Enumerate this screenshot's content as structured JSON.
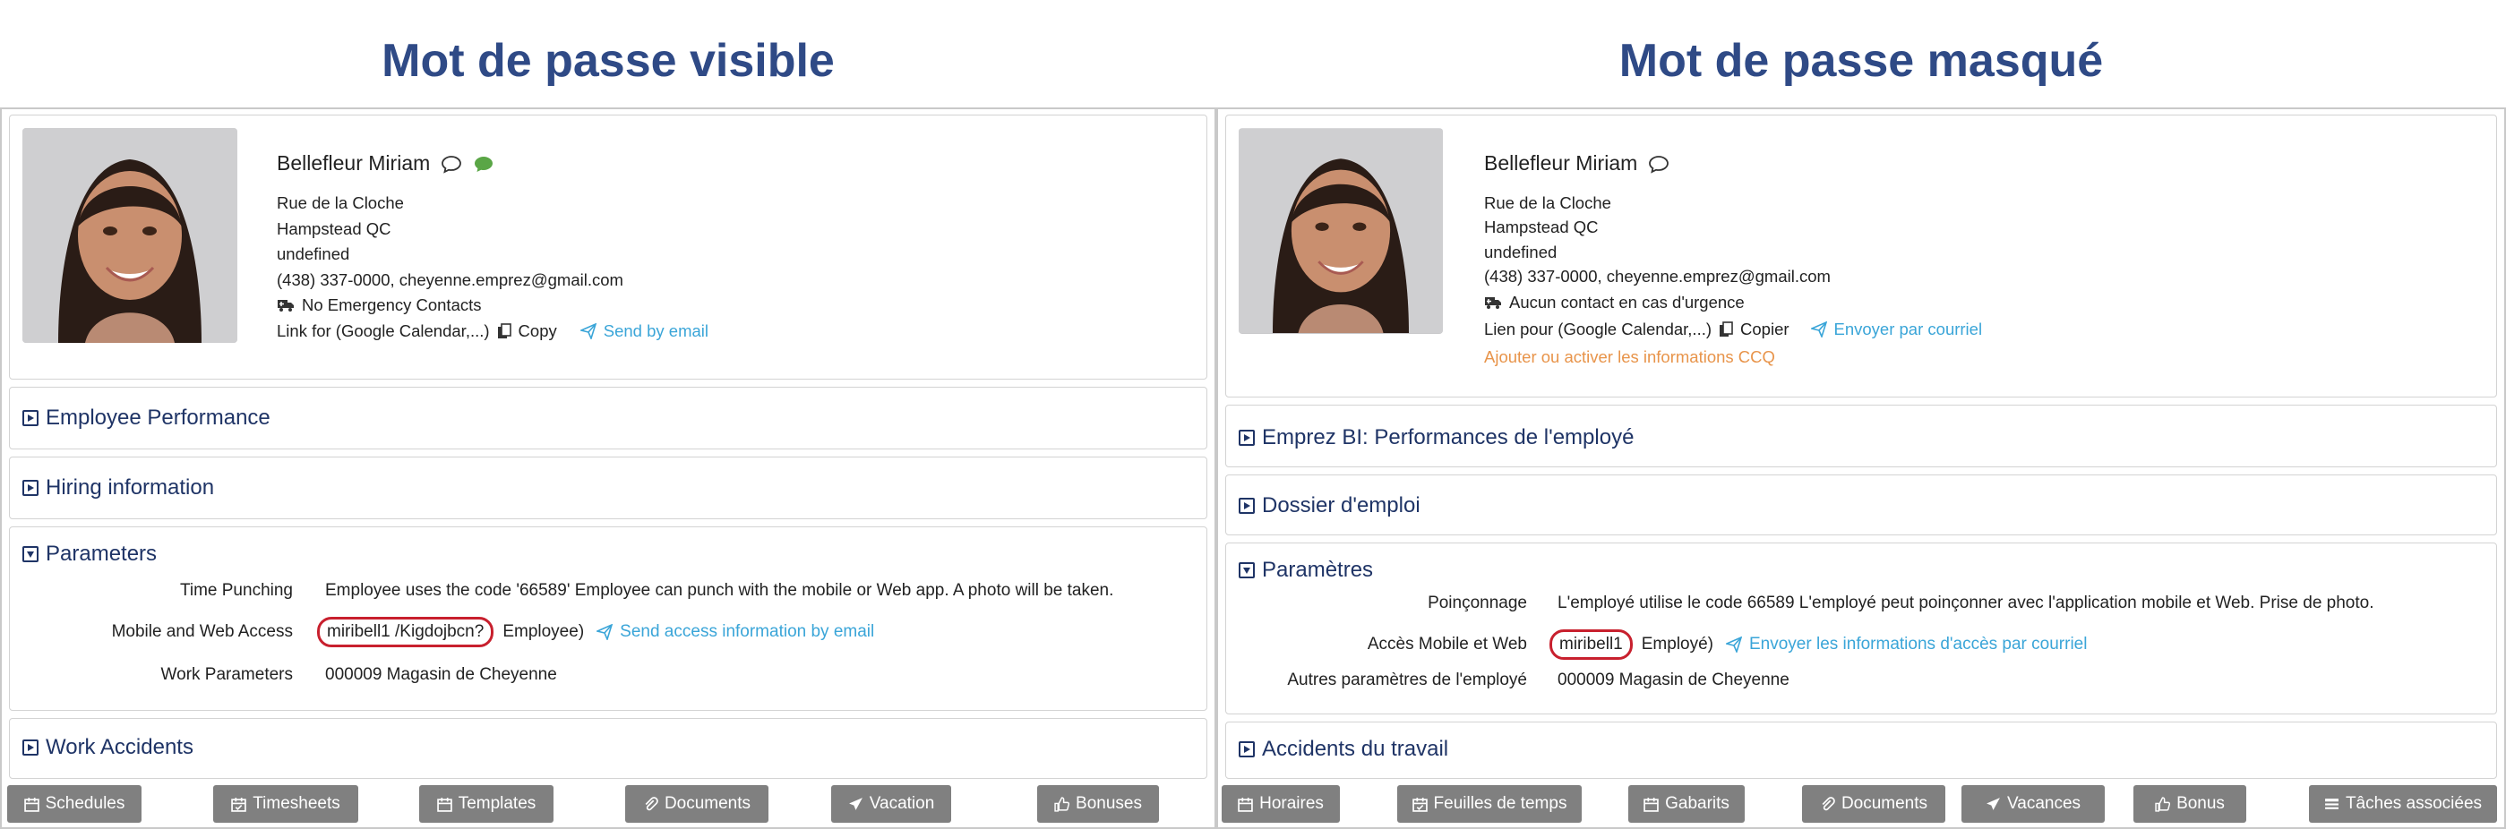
{
  "headings": {
    "left": "Mot de passe visible",
    "right": "Mot de passe masqué"
  },
  "left": {
    "profile": {
      "name": "Bellefleur Miriam",
      "address1": "Rue de la Cloche",
      "address2": "Hampstead QC",
      "line3": "undefined",
      "contact": "(438) 337-0000, cheyenne.emprez@gmail.com",
      "emergency": "No Emergency Contacts",
      "link_label": "Link for (Google Calendar,...)",
      "copy_label": "Copy",
      "send_label": "Send by email"
    },
    "sections": {
      "performance": "Employee Performance",
      "hiring": "Hiring information",
      "parameters": "Parameters",
      "accidents": "Work Accidents"
    },
    "params": {
      "time_punching_label": "Time Punching",
      "time_punching_value": "Employee uses the code '66589' Employee can punch with the mobile or Web app. A photo will be taken.",
      "access_label": "Mobile and Web Access",
      "access_credentials": "miribell1 /Kigdojbcn?",
      "access_role": "Employee)",
      "access_send": "Send access information by email",
      "work_label": "Work Parameters",
      "work_value": "000009 Magasin de Cheyenne"
    },
    "buttons": [
      "Schedules",
      "Timesheets",
      "Templates",
      "Documents",
      "Vacation",
      "Bonuses"
    ]
  },
  "right": {
    "profile": {
      "name": "Bellefleur Miriam",
      "address1": "Rue de la Cloche",
      "address2": "Hampstead QC",
      "line3": "undefined",
      "contact": "(438) 337-0000, cheyenne.emprez@gmail.com",
      "emergency": "Aucun contact en cas d'urgence",
      "link_label": "Lien pour (Google Calendar,...)",
      "copy_label": "Copier",
      "send_label": "Envoyer par courriel",
      "ccq": "Ajouter ou activer les informations CCQ"
    },
    "sections": {
      "performance": "Emprez BI: Performances de l'employé",
      "hiring": "Dossier d'emploi",
      "parameters": "Paramètres",
      "accidents": "Accidents du travail"
    },
    "params": {
      "time_punching_label": "Poinçonnage",
      "time_punching_value": "L'employé utilise le code 66589 L'employé peut poinçonner avec l'application mobile et Web. Prise de photo.",
      "access_label": "Accès Mobile et Web",
      "access_credentials": "miribell1",
      "access_role": "Employé)",
      "access_send": "Envoyer les informations d'accès par courriel",
      "work_label": "Autres paramètres de l'employé",
      "work_value": "000009 Magasin de Cheyenne"
    },
    "buttons": [
      "Horaires",
      "Feuilles de temps",
      "Gabarits",
      "Documents",
      "Vacances",
      "Bonus",
      "Tâches associées"
    ]
  },
  "colors": {
    "heading": "#2f4a86",
    "section_title": "#1f3466",
    "link": "#3aa5d8",
    "highlight_ring": "#c8202e",
    "button_bg": "#808080",
    "ccq_link": "#e8944a"
  }
}
